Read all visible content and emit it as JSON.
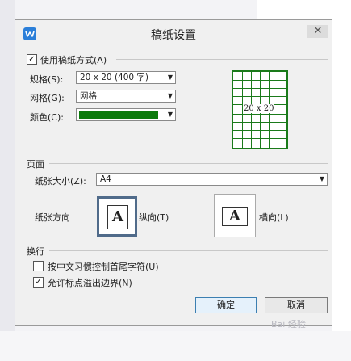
{
  "dialog": {
    "title": "稿纸设置",
    "close_glyph": "✕"
  },
  "paper_style": {
    "use_paper_label": "使用稿纸方式(A)",
    "use_paper_checked": true,
    "spec_label": "规格(S):",
    "spec_value": "20 x 20 (400 字)",
    "grid_label": "网格(G):",
    "grid_value": "网格",
    "color_label": "颜色(C):",
    "color_value": "#0b7a0b",
    "preview_text": "20 x 20"
  },
  "page": {
    "section_label": "页面",
    "paper_size_label": "纸张大小(Z):",
    "paper_size_value": "A4",
    "orientation_label": "纸张方向",
    "portrait_label": "纵向(T)",
    "landscape_label": "横向(L)",
    "page_icon_letter": "A",
    "selected": "portrait"
  },
  "line_break": {
    "section_label": "换行",
    "option1_label": "按中文习惯控制首尾字符(U)",
    "option1_checked": false,
    "option2_label": "允许标点溢出边界(N)",
    "option2_checked": true
  },
  "buttons": {
    "ok_label": "确定",
    "cancel_label": "取消"
  },
  "icons": {
    "app": "wps-writer-icon",
    "close": "close-icon",
    "dropdown": "chevron-down-icon",
    "portrait": "portrait-page-icon",
    "landscape": "landscape-page-icon"
  },
  "watermark": "Bai 经验"
}
